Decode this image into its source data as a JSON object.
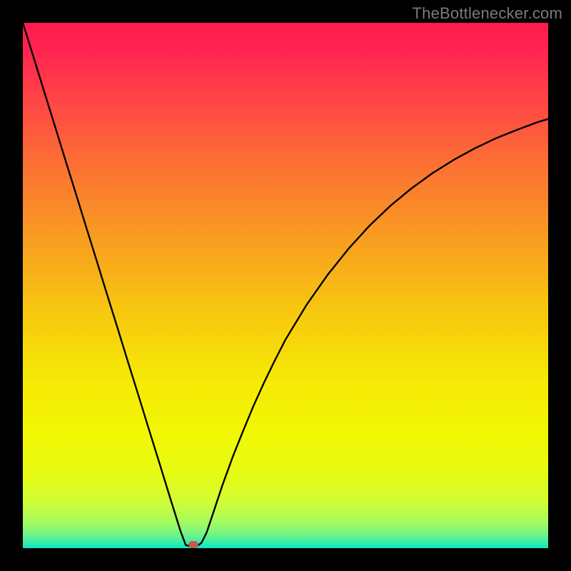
{
  "watermark": "TheBottlenecker.com",
  "chart_data": {
    "type": "line",
    "title": "",
    "xlabel": "",
    "ylabel": "",
    "xlim": [
      0,
      100
    ],
    "ylim": [
      0,
      100
    ],
    "series": [
      {
        "name": "bottleneck-curve",
        "x": [
          0,
          2,
          4,
          6,
          8,
          10,
          12,
          14,
          16,
          18,
          20,
          22,
          24,
          26,
          28,
          30,
          31,
          32,
          33,
          34,
          35,
          36,
          38,
          40,
          42,
          44,
          46,
          48,
          50,
          54,
          58,
          62,
          66,
          70,
          74,
          78,
          82,
          86,
          90,
          94,
          98,
          100
        ],
        "y": [
          100,
          93.6,
          87.1,
          80.7,
          74.2,
          67.8,
          61.3,
          54.9,
          48.4,
          42.0,
          35.5,
          29.1,
          22.6,
          16.2,
          9.7,
          3.3,
          0.6,
          0.3,
          0.3,
          1.0,
          3.0,
          6.0,
          12.0,
          17.5,
          22.5,
          27.3,
          31.7,
          35.8,
          39.7,
          46.3,
          52.0,
          57.0,
          61.4,
          65.2,
          68.5,
          71.4,
          73.9,
          76.1,
          78.0,
          79.6,
          81.1,
          81.7
        ]
      }
    ],
    "marker": {
      "x": 32.5,
      "y": 0.7,
      "color": "#c55a4a"
    },
    "gradient": {
      "stops": [
        {
          "offset": 0.0,
          "color": "#ff1a4f"
        },
        {
          "offset": 0.06,
          "color": "#ff2750"
        },
        {
          "offset": 0.15,
          "color": "#ff4645"
        },
        {
          "offset": 0.28,
          "color": "#fb7432"
        },
        {
          "offset": 0.42,
          "color": "#f8a01f"
        },
        {
          "offset": 0.55,
          "color": "#f7c80f"
        },
        {
          "offset": 0.68,
          "color": "#f6e906"
        },
        {
          "offset": 0.78,
          "color": "#f2f703"
        },
        {
          "offset": 0.86,
          "color": "#e6fb14"
        },
        {
          "offset": 0.91,
          "color": "#d1fd33"
        },
        {
          "offset": 0.95,
          "color": "#a6fb5e"
        },
        {
          "offset": 0.975,
          "color": "#6ef588"
        },
        {
          "offset": 0.99,
          "color": "#34eeac"
        },
        {
          "offset": 1.0,
          "color": "#0be9c3"
        }
      ]
    }
  }
}
